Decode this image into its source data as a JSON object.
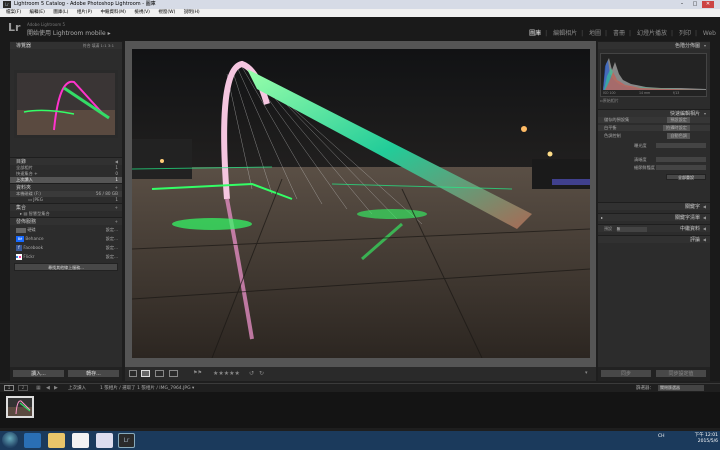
{
  "window": {
    "title": "Lightroom 5 Catalog - Adobe Photoshop Lightroom - 圖庫",
    "controls": [
      "–",
      "□",
      "✕"
    ]
  },
  "menubar": [
    "檔案(F)",
    "編輯(E)",
    "圖庫(L)",
    "相片(P)",
    "中繼資料(M)",
    "檢視(V)",
    "視窗(W)",
    "說明(H)"
  ],
  "header": {
    "logo": "Lr",
    "subtitle": "Adobe Lightroom 5",
    "sync_label": "開始使用 Lightroom mobile ▸",
    "modules": [
      "圖庫",
      "編輯相片",
      "地圖",
      "書冊",
      "幻燈片播放",
      "列印",
      "Web"
    ],
    "active_module": "圖庫"
  },
  "left": {
    "navigator": {
      "title": "導覽器",
      "zoom_options": [
        "符合",
        "填滿",
        "1:1",
        "3:1"
      ]
    },
    "catalog": {
      "title": "目錄",
      "items": [
        {
          "label": "全部相片",
          "count": "1"
        },
        {
          "label": "快速集合 +",
          "count": "0"
        },
        {
          "label": "上次讀入",
          "count": "1"
        }
      ]
    },
    "folders": {
      "title": "資料夾",
      "drive_label": "本機磁碟 (F:)",
      "drive_space": "56 / 80 GB",
      "folder_label": "JPEG",
      "folder_count": "1"
    },
    "collections": {
      "title": "集合",
      "items": [
        {
          "label": "智慧型集合"
        }
      ]
    },
    "publish": {
      "title": "發佈服務",
      "services": [
        {
          "label": "硬碟",
          "action": "設定..."
        },
        {
          "label": "Behance",
          "action": "設定..."
        },
        {
          "label": "Facebook",
          "action": "設定..."
        },
        {
          "label": "Flickr",
          "action": "設定..."
        }
      ],
      "more_button": "尋找其他線上服務..."
    },
    "import_button": "讀入...",
    "export_button": "轉存..."
  },
  "right": {
    "histogram": {
      "title": "色階分佈圖",
      "readout_left": "ISO 100",
      "readout_mid": "14 mm",
      "readout_right": "f/13",
      "original_label": "原始相片"
    },
    "quick_develop": {
      "title": "快速編輯相片",
      "preset_label": "儲存的預設集",
      "preset_value": "預設設定",
      "wb_label": "白平衡",
      "wb_value": "拍攝時設定",
      "tone_label": "色調控制",
      "tone_value": "自動色調",
      "sliders": [
        "曝光度",
        "清晰度",
        "細節鮮豔度"
      ],
      "reset_button": "全部重設"
    },
    "keywords_title": "關鍵字",
    "keyword_list_title": "關鍵字清單",
    "metadata_title": "中繼資料",
    "metadata_preset_label": "預設",
    "metadata_preset_value": "無",
    "comments_title": "評論",
    "sync_button": "同步",
    "sync_settings_button": "同步設定值"
  },
  "toolbar": {
    "stars": "★★★★★",
    "flag_label": "排序"
  },
  "filmstrip": {
    "pages": [
      "1",
      "2"
    ],
    "source_label": "上次讀入",
    "info": "1 張相片 / 選取了 1 張相片 / IMG_7964.JPG ▾",
    "filter_label": "篩選器：",
    "filter_value": "關閉篩選器"
  },
  "taskbar": {
    "time": "下午 12:01",
    "date": "2015/5/6",
    "lang": "CH"
  },
  "colors": {
    "accent": "#e8e8e8",
    "panel": "#2c2c2c",
    "taskbar": "#1b3a5c"
  }
}
